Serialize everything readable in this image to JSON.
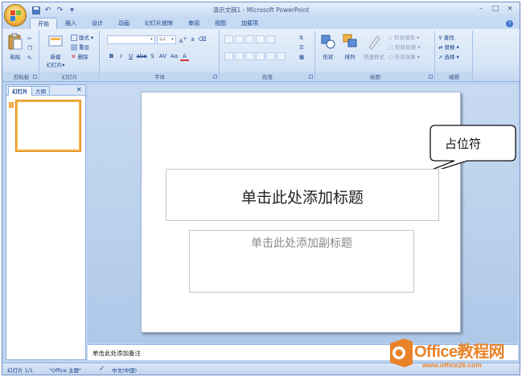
{
  "window": {
    "title": "演示文稿1 - Microsoft PowerPoint",
    "controls": [
      "–",
      "□",
      "×"
    ]
  },
  "qat": {
    "icons": [
      "save-icon",
      "undo-icon",
      "redo-icon"
    ]
  },
  "tabs": [
    {
      "label": "开始",
      "active": true
    },
    {
      "label": "插入"
    },
    {
      "label": "设计"
    },
    {
      "label": "动画"
    },
    {
      "label": "幻灯片放映"
    },
    {
      "label": "审阅"
    },
    {
      "label": "视图"
    },
    {
      "label": "加载项"
    }
  ],
  "ribbon": {
    "clipboard": {
      "paste": "粘贴",
      "label": "剪贴板"
    },
    "slides": {
      "new_slide": "新建\n幻灯片",
      "layout": "版式",
      "reset": "重设",
      "delete": "删除",
      "label": "幻灯片"
    },
    "font": {
      "size": "44",
      "label": "字体",
      "buttons": [
        "B",
        "I",
        "U",
        "abe",
        "S",
        "AV",
        "Aa",
        "A"
      ]
    },
    "paragraph": {
      "label": "段落"
    },
    "drawing": {
      "shapes": "形状",
      "arrange": "排列",
      "quick_styles": "快速样式",
      "fill": "形状填充",
      "outline": "形状轮廓",
      "effects": "形状效果",
      "label": "绘图"
    },
    "editing": {
      "find": "查找",
      "replace": "替换",
      "select": "选择",
      "label": "编辑"
    }
  },
  "pane": {
    "tab_slides": "幻灯片",
    "tab_outline": "大纲",
    "close": "×",
    "slide_number": "1"
  },
  "slide": {
    "title_placeholder": "单击此处添加标题",
    "subtitle_placeholder": "单击此处添加副标题"
  },
  "callout": {
    "text": "占位符"
  },
  "notes": {
    "placeholder": "单击此处添加备注"
  },
  "status": {
    "slide_info": "幻灯片 1/1",
    "theme": "\"Office 主题\"",
    "language": "中文(中国)"
  },
  "watermark": {
    "title": "Office教程网",
    "url": "www.office26.com",
    "logo_letter": "O"
  },
  "colors": {
    "accent": "#e8832a",
    "ribbon": "#d5e4f7",
    "frame": "#bfd3ee"
  }
}
